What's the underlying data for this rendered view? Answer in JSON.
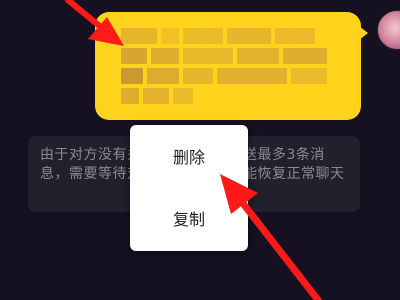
{
  "notice": {
    "text": "由于对方没有关注你，你只能发送最多3条消息，需要等待对方关注回复后才能恢复正常聊天"
  },
  "context_menu": {
    "delete_label": "删除",
    "copy_label": "复制"
  },
  "colors": {
    "background": "#151121",
    "bubble": "#ffd21c",
    "notice_bg": "#22202c",
    "notice_text": "#8d8a96",
    "menu_bg": "#ffffff",
    "arrow": "#ff1a1a"
  },
  "icons": {
    "arrow_top": "annotation-arrow",
    "arrow_bottom": "annotation-arrow"
  }
}
